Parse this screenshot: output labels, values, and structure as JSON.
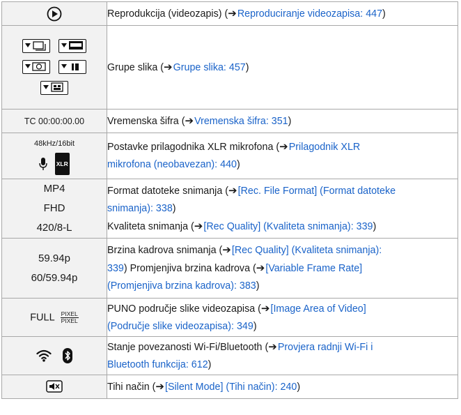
{
  "rows": [
    {
      "icon": "play-circle-icon",
      "label": "Reprodukcija (videozapis) (",
      "link": "Reproduciranje videozapisa: 447",
      "close": ")"
    },
    {
      "icon": "group-images-icons",
      "label": "Grupe slika (",
      "link": "Grupe slika: 457",
      "close": ")"
    },
    {
      "icon_text": "TC 00:00:00.00",
      "label": "Vremenska šifra (",
      "link": "Vremenska šifra: 351",
      "close": ")"
    },
    {
      "icon_text": "48kHz/16bit",
      "xlr": "XLR",
      "label": "Postavke prilagodnika XLR mikrofona (",
      "link_line1": "Prilagodnik XLR",
      "link_line2": "mikrofona (neobavezan): 440",
      "close": ")"
    },
    {
      "icon_lines": [
        "MP4",
        "FHD",
        "420/8-L"
      ],
      "label": "Format datoteke snimanja (",
      "link_line1": "[Rec. File Format] (Format datoteke",
      "link_line2": "snimanja): 338",
      "close": ")",
      "label2": "Kvaliteta snimanja (",
      "link2": "[Rec Quality] (Kvaliteta snimanja): 339",
      "close2": ")"
    },
    {
      "icon_lines": [
        "59.94p",
        "60/59.94p"
      ],
      "label": "Brzina kadrova snimanja (",
      "link_line1": "[Rec Quality] (Kvaliteta snimanja):",
      "link_line2": "339",
      "close": ") Promjenjiva brzina kadrova (",
      "link2_line1": "[Variable Frame Rate]",
      "link2_line2": "(Promjenjiva brzina kadrova): 383",
      "close2": ")"
    },
    {
      "icon_text": "FULL",
      "frac_top": "PIXEL",
      "frac_bottom": "PIXEL",
      "label": "PUNO područje slike videozapisa (",
      "link_line1": "[Image Area of Video]",
      "link_line2": "(Područje slike videozapisa): 349",
      "close": ")"
    },
    {
      "icon": "wifi-bluetooth-icons",
      "label": "Stanje povezanosti Wi-Fi/Bluetooth (",
      "link_line1": "Provjera radnji Wi-Fi i",
      "link_line2": "Bluetooth funkcija: 612",
      "close": ")"
    },
    {
      "icon": "silent-mode-icon",
      "label": "Tihi način (",
      "link": "[Silent Mode] (Tihi način): 240",
      "close": ")"
    }
  ],
  "arrow_glyph": "➔",
  "link_color": "#1a63c9"
}
